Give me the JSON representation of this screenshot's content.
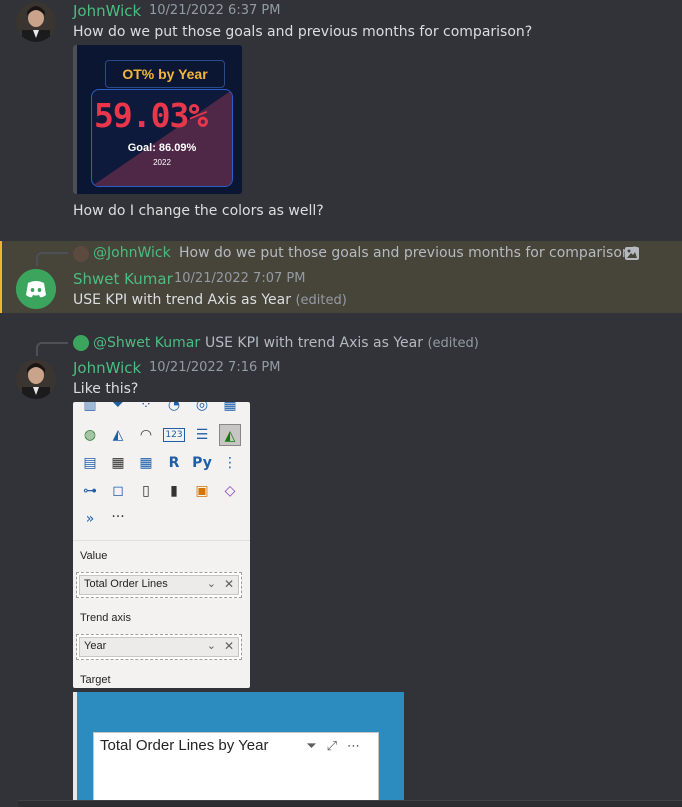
{
  "messages": [
    {
      "username": "JohnWick",
      "timestamp": "10/21/2022 6:37 PM",
      "text": "How do we put those goals and previous months for comparison?",
      "followup": "How do I change the colors as well?",
      "image": {
        "title": "OT% by Year",
        "value": "59.03%",
        "goal": "Goal: 86.09%",
        "year": "2022"
      }
    },
    {
      "reply": {
        "mention": "@JohnWick",
        "text": "How do we put those goals and previous months for comparison?"
      },
      "username": "Shwet Kumar",
      "timestamp": "10/21/2022 7:07 PM",
      "text": "USE KPI with trend Axis as Year",
      "edited": "(edited)"
    },
    {
      "reply": {
        "mention": "@Shwet Kumar",
        "text": "USE KPI with trend Axis as Year",
        "edited": "(edited)"
      },
      "username": "JohnWick",
      "timestamp": "10/21/2022 7:16 PM",
      "text": "Like this?",
      "pane": {
        "value_label": "Value",
        "value_field": "Total Order Lines",
        "trend_label": "Trend axis",
        "trend_field": "Year",
        "target_label": "Target",
        "more": "···",
        "r_label": "R",
        "py_label": "Py"
      },
      "image2": {
        "title": "Total Order Lines by Year"
      }
    }
  ],
  "colors": {
    "background": "#313338",
    "username": "#4bbd7f",
    "highlight_bar": "#f0b232",
    "kpi_value": "#e8374a",
    "kpi_title": "#f4b63a"
  }
}
